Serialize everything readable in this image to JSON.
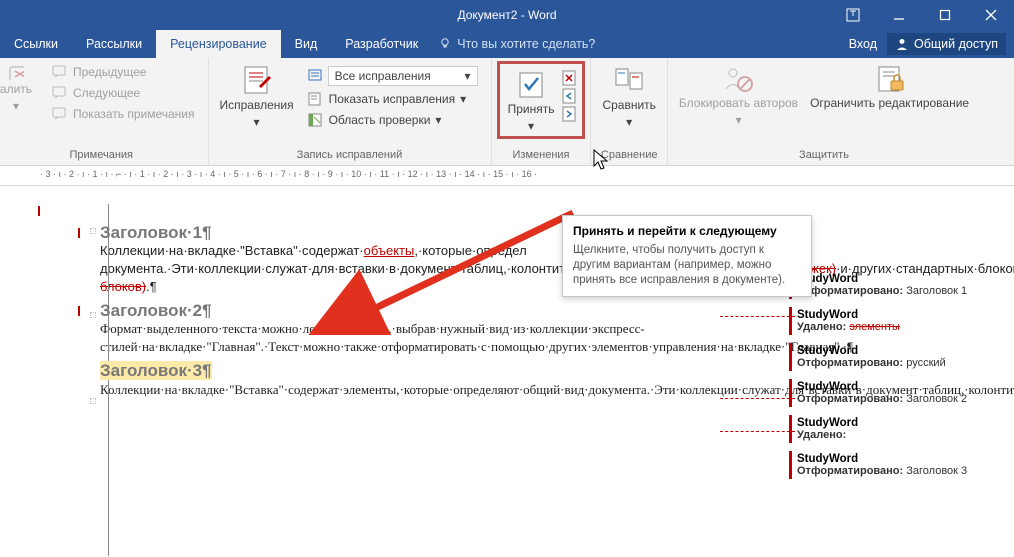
{
  "titlebar": {
    "title": "Документ2 - Word"
  },
  "auth": {
    "login": "Вход",
    "share": "Общий доступ"
  },
  "tabs": {
    "items": [
      "Ссылки",
      "Рассылки",
      "Рецензирование",
      "Вид",
      "Разработчик"
    ],
    "tellme": "Что вы хотите сделать?"
  },
  "ribbon": {
    "comments": {
      "delete": "алить",
      "prev": "Предыдущее",
      "next": "Следующее",
      "show": "Показать примечания",
      "label": "Примечания"
    },
    "tracking": {
      "main": "Исправления",
      "display_dd": "Все исправления",
      "show_markup": "Показать исправления",
      "pane": "Область проверки",
      "label": "Запись исправлений"
    },
    "changes": {
      "accept": "Принять",
      "label": "Изменения"
    },
    "compare": {
      "btn": "Сравнить",
      "label": "Сравнение"
    },
    "protect": {
      "block": "Блокировать авторов",
      "restrict": "Ограничить редактирование",
      "label": "Защитить"
    }
  },
  "tooltip": {
    "title": "Принять и перейти к следующему",
    "body": "Щелкните, чтобы получить доступ к другим вариантам (например, можно принять все исправления в документе)."
  },
  "ruler": "· 3 · ı · 2 · ı · 1 · ı · ⌐ · ı · 1 · ı · 2 · ı · 3 · ı · 4 · ı · 5 · ı · 6 · ı · 7 · ı · 8 · ı · 9 · ı · 10 · ı · 11 · ı · 12 · ı · 13 · ı · 14 · ı · 15 · ı · 16 ·",
  "doc": {
    "h1": "Заголовок·1¶",
    "p1a": "Коллекции·на·вкладке·\"Вставка\"·содержат·",
    "p1_ins": "объекты",
    "p1b": ",·которые·определ",
    "p1c": "документа.·Эти·коллекции·служат·для·вставки·в·документ·таблиц,·колонтитулов,·списков,·титульных·страниц·",
    "p1_del": "(обложек)",
    "p1d": "·и·других·стандартных·блоков·",
    "p1_del2": "(экспресс-блоков)",
    "p1e": ".¶",
    "h2": "Заголовок·2¶",
    "p2": "Формат·выделенного·текста·можно·легко·изменить,·выбрав·нужный·вид·из·коллекции·экспресс-стилей·на·вкладке·\"Главная\".·Текст·можно·также·отформатировать·с·помощью·других·элементов·управления·на·вкладке·\"Главная\".·¶",
    "h3": "Заголовок·3¶",
    "p3": "Коллекции·на·вкладке·\"Вставка\"·содержат·элементы,·которые·определяют·общий·вид·документа.·Эти·коллекции·служат·для·вставки·в·документ·таблиц,·колонтитулов,·списков,·титульных·страниц·и·других·стандартных·блоков.¶"
  },
  "markup": {
    "items": [
      {
        "author": "StudyWord",
        "kind": "Отформатировано:",
        "val": "Заголовок 1"
      },
      {
        "author": "StudyWord",
        "kind": "Удалено:",
        "val": "элементы"
      },
      {
        "author": "StudyWord",
        "kind": "Отформатировано:",
        "val": "русский"
      },
      {
        "author": "StudyWord",
        "kind": "Отформатировано:",
        "val": "Заголовок 2"
      },
      {
        "author": "StudyWord",
        "kind": "Удалено:",
        "val": ""
      },
      {
        "author": "StudyWord",
        "kind": "Отформатировано:",
        "val": "Заголовок 3"
      }
    ]
  }
}
